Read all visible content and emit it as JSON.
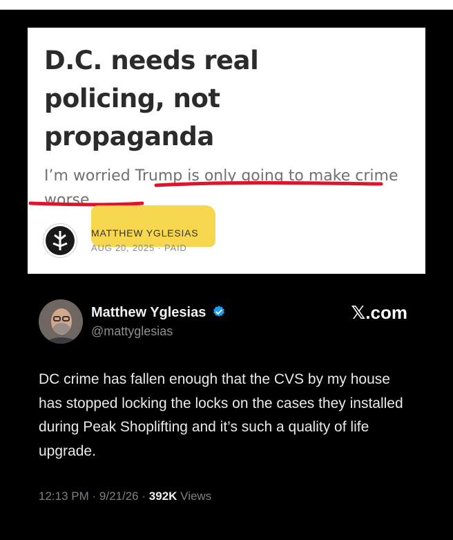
{
  "article": {
    "headline": [
      "D.C. needs real",
      "policing, not",
      "propaganda"
    ],
    "subtitle": "I’m worried Trump is only going to make crime worse",
    "author": "MATTHEW YGLESIAS",
    "date": "AUG 20, 2025",
    "separator": "·",
    "access": "PAID",
    "highlight_color": "#f5d33a",
    "underline_color": "#e0132b"
  },
  "tweet": {
    "display_name": "Matthew Yglesias",
    "handle": "@mattyglesias",
    "source": "𝕏.com",
    "body": "DC crime has fallen enough that the CVS by my house has stopped locking the locks on the cases they installed during Peak Shoplifting and it’s such a quality of life upgrade.",
    "time": "12:13 PM",
    "date": "9/21/26",
    "separator": "·",
    "views_count": "392K",
    "views_label": "Views",
    "verified_color": "#1d9bf0"
  }
}
